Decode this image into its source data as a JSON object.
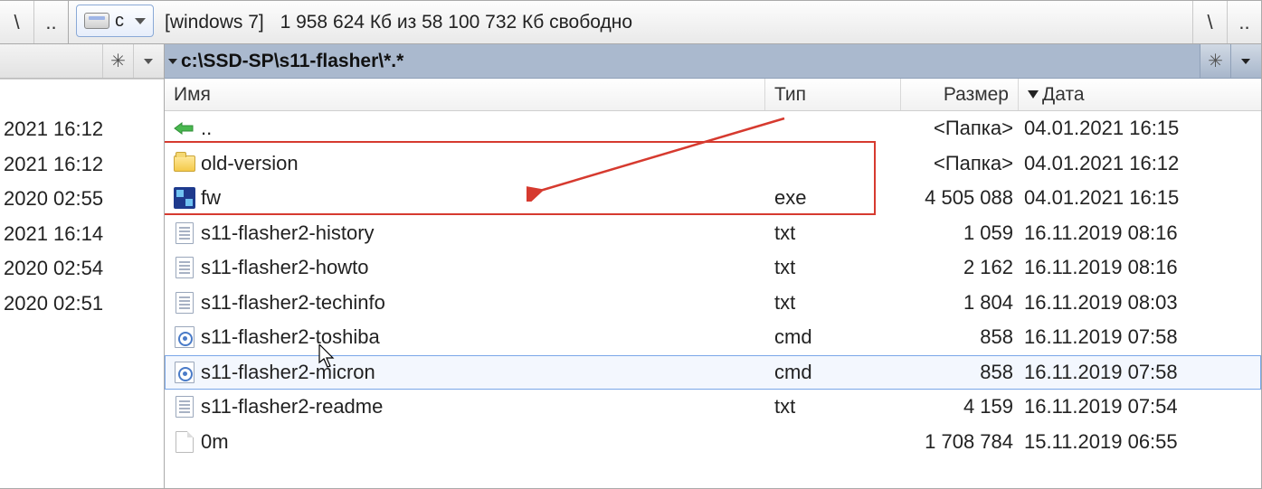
{
  "topbar": {
    "root": "\\",
    "up": "..",
    "drive_letter": "c",
    "volume_label": "[windows 7]",
    "disk_free": "1 958 624 Кб из 58 100 732 Кб свободно"
  },
  "right_top": {
    "root": "\\",
    "up": ".."
  },
  "path": "c:\\SSD-SP\\s11-flasher\\*.*",
  "columns": {
    "name": "Имя",
    "type": "Тип",
    "size": "Размер",
    "date": "Дата"
  },
  "files": [
    {
      "icon": "up",
      "name": "..",
      "type": "",
      "size": "<Папка>",
      "date": "04.01.2021 16:15"
    },
    {
      "icon": "folder",
      "name": "old-version",
      "type": "",
      "size": "<Папка>",
      "date": "04.01.2021 16:12"
    },
    {
      "icon": "exe",
      "name": "fw",
      "type": "exe",
      "size": "4 505 088",
      "date": "04.01.2021 16:15"
    },
    {
      "icon": "txt",
      "name": "s11-flasher2-history",
      "type": "txt",
      "size": "1 059",
      "date": "16.11.2019 08:16"
    },
    {
      "icon": "txt",
      "name": "s11-flasher2-howto",
      "type": "txt",
      "size": "2 162",
      "date": "16.11.2019 08:16"
    },
    {
      "icon": "txt",
      "name": "s11-flasher2-techinfo",
      "type": "txt",
      "size": "1 804",
      "date": "16.11.2019 08:03"
    },
    {
      "icon": "cmd",
      "name": "s11-flasher2-toshiba",
      "type": "cmd",
      "size": "858",
      "date": "16.11.2019 07:58"
    },
    {
      "icon": "cmd",
      "name": "s11-flasher2-micron",
      "type": "cmd",
      "size": "858",
      "date": "16.11.2019 07:58",
      "selected": true
    },
    {
      "icon": "txt",
      "name": "s11-flasher2-readme",
      "type": "txt",
      "size": "4 159",
      "date": "16.11.2019 07:54"
    },
    {
      "icon": "blank",
      "name": "0m",
      "type": "",
      "size": "1 708 784",
      "date": "15.11.2019 06:55"
    }
  ],
  "left_dates": [
    "2021 16:12",
    "2021 16:12",
    "2020 02:55",
    "2021 16:14",
    "2020 02:54",
    "2020 02:51"
  ]
}
